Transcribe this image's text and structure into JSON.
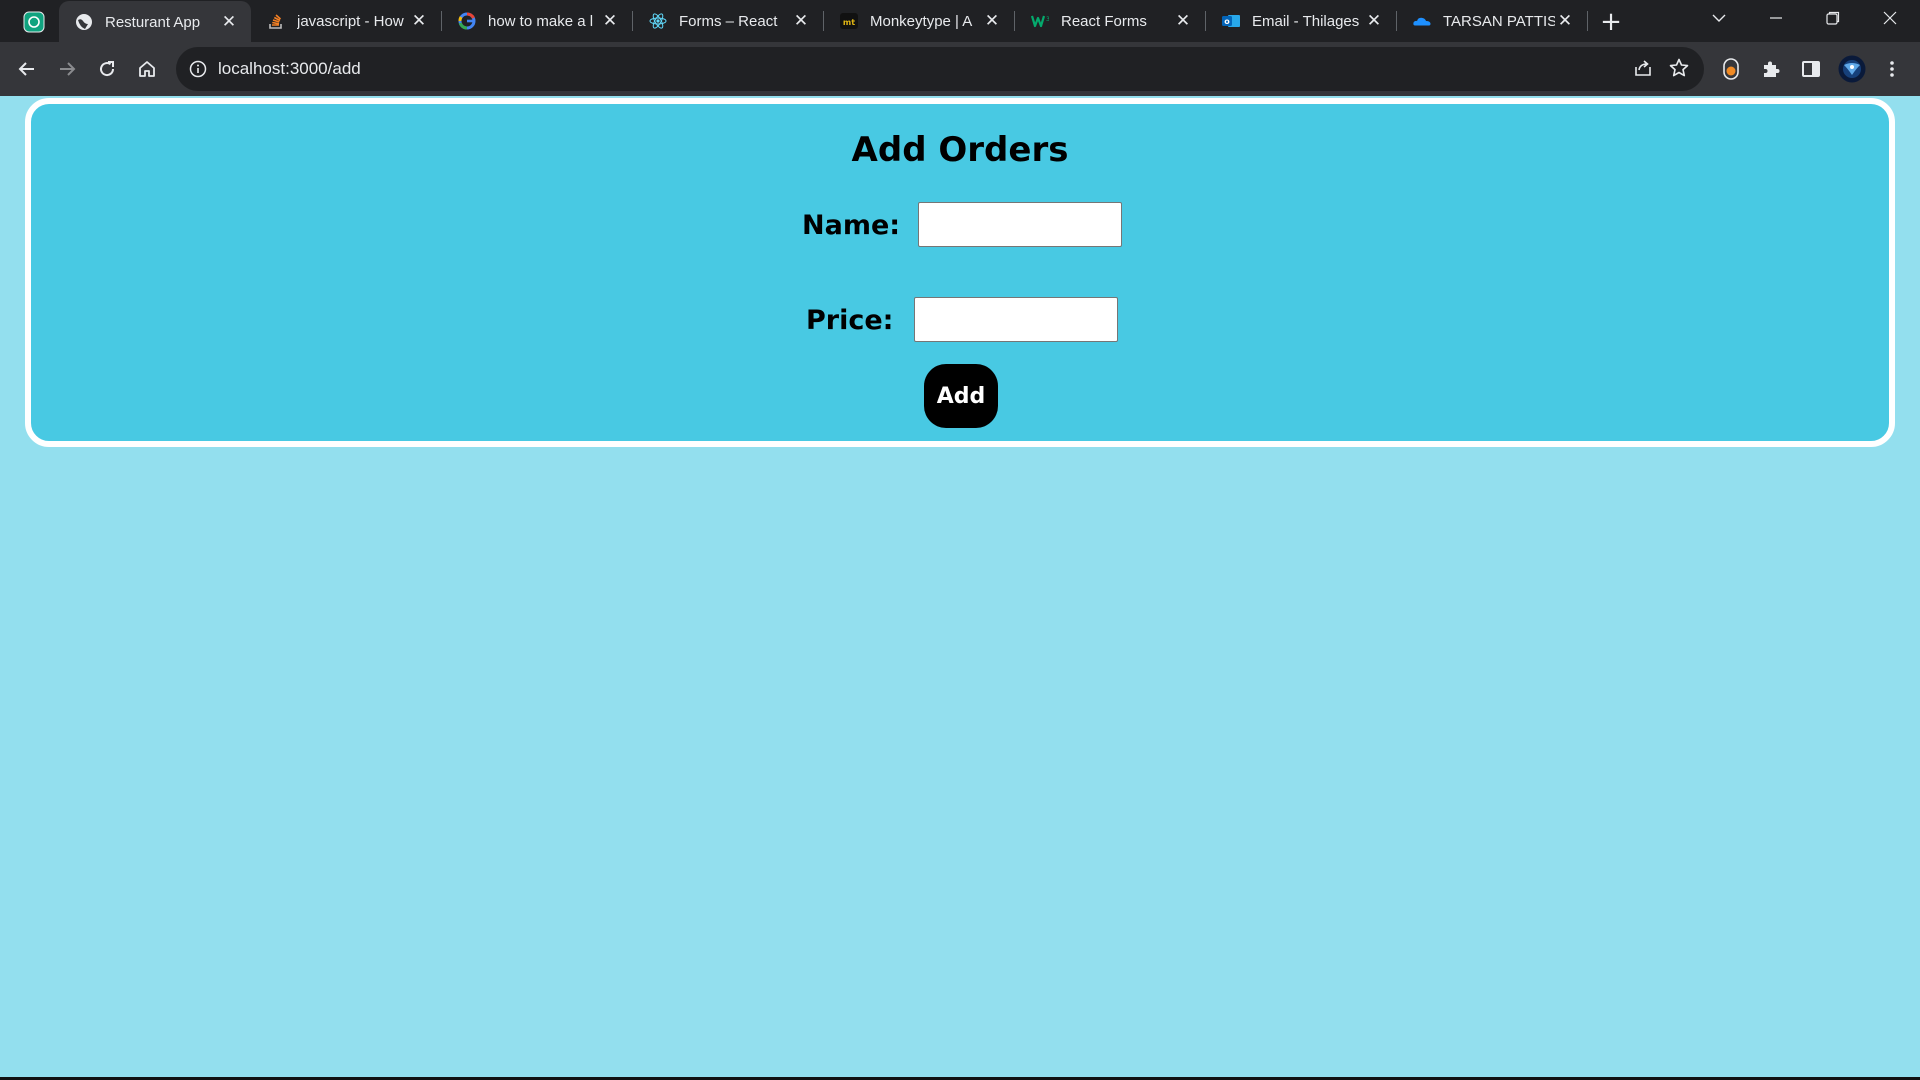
{
  "browser": {
    "tabs": [
      {
        "title": "Resturant App",
        "favicon": "globe-icon",
        "active": true
      },
      {
        "title": "javascript - How",
        "favicon": "stackoverflow-icon",
        "active": false
      },
      {
        "title": "how to make a l",
        "favicon": "google-icon",
        "active": false
      },
      {
        "title": "Forms – React",
        "favicon": "react-icon",
        "active": false
      },
      {
        "title": "Monkeytype | A",
        "favicon": "monkeytype-icon",
        "active": false
      },
      {
        "title": "React Forms",
        "favicon": "w3schools-icon",
        "active": false
      },
      {
        "title": "Email - Thilages",
        "favicon": "outlook-icon",
        "active": false
      },
      {
        "title": "TARSAN PATTIS",
        "favicon": "onedrive-icon",
        "active": false
      }
    ],
    "url": "localhost:3000/add",
    "close_glyph": "✕",
    "newtab_glyph": "+"
  },
  "page": {
    "heading": "Add Orders",
    "name_label": "Name:",
    "price_label": "Price:",
    "name_value": "",
    "price_value": "",
    "add_button": "Add"
  },
  "colors": {
    "page_bg": "#93dfee",
    "card_bg": "#48c9e3",
    "card_border": "#ffffff",
    "button_bg": "#000000",
    "tabstrip_bg": "#202124",
    "toolbar_bg": "#35363a"
  }
}
